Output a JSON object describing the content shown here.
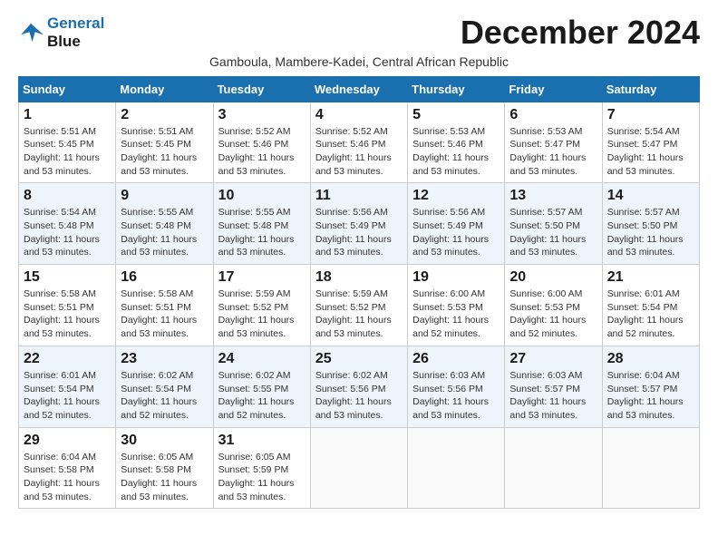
{
  "header": {
    "logo_line1": "General",
    "logo_line2": "Blue",
    "title": "December 2024",
    "subtitle": "Gamboula, Mambere-Kadei, Central African Republic"
  },
  "weekdays": [
    "Sunday",
    "Monday",
    "Tuesday",
    "Wednesday",
    "Thursday",
    "Friday",
    "Saturday"
  ],
  "weeks": [
    [
      {
        "day": "1",
        "detail": "Sunrise: 5:51 AM\nSunset: 5:45 PM\nDaylight: 11 hours\nand 53 minutes."
      },
      {
        "day": "2",
        "detail": "Sunrise: 5:51 AM\nSunset: 5:45 PM\nDaylight: 11 hours\nand 53 minutes."
      },
      {
        "day": "3",
        "detail": "Sunrise: 5:52 AM\nSunset: 5:46 PM\nDaylight: 11 hours\nand 53 minutes."
      },
      {
        "day": "4",
        "detail": "Sunrise: 5:52 AM\nSunset: 5:46 PM\nDaylight: 11 hours\nand 53 minutes."
      },
      {
        "day": "5",
        "detail": "Sunrise: 5:53 AM\nSunset: 5:46 PM\nDaylight: 11 hours\nand 53 minutes."
      },
      {
        "day": "6",
        "detail": "Sunrise: 5:53 AM\nSunset: 5:47 PM\nDaylight: 11 hours\nand 53 minutes."
      },
      {
        "day": "7",
        "detail": "Sunrise: 5:54 AM\nSunset: 5:47 PM\nDaylight: 11 hours\nand 53 minutes."
      }
    ],
    [
      {
        "day": "8",
        "detail": "Sunrise: 5:54 AM\nSunset: 5:48 PM\nDaylight: 11 hours\nand 53 minutes."
      },
      {
        "day": "9",
        "detail": "Sunrise: 5:55 AM\nSunset: 5:48 PM\nDaylight: 11 hours\nand 53 minutes."
      },
      {
        "day": "10",
        "detail": "Sunrise: 5:55 AM\nSunset: 5:48 PM\nDaylight: 11 hours\nand 53 minutes."
      },
      {
        "day": "11",
        "detail": "Sunrise: 5:56 AM\nSunset: 5:49 PM\nDaylight: 11 hours\nand 53 minutes."
      },
      {
        "day": "12",
        "detail": "Sunrise: 5:56 AM\nSunset: 5:49 PM\nDaylight: 11 hours\nand 53 minutes."
      },
      {
        "day": "13",
        "detail": "Sunrise: 5:57 AM\nSunset: 5:50 PM\nDaylight: 11 hours\nand 53 minutes."
      },
      {
        "day": "14",
        "detail": "Sunrise: 5:57 AM\nSunset: 5:50 PM\nDaylight: 11 hours\nand 53 minutes."
      }
    ],
    [
      {
        "day": "15",
        "detail": "Sunrise: 5:58 AM\nSunset: 5:51 PM\nDaylight: 11 hours\nand 53 minutes."
      },
      {
        "day": "16",
        "detail": "Sunrise: 5:58 AM\nSunset: 5:51 PM\nDaylight: 11 hours\nand 53 minutes."
      },
      {
        "day": "17",
        "detail": "Sunrise: 5:59 AM\nSunset: 5:52 PM\nDaylight: 11 hours\nand 53 minutes."
      },
      {
        "day": "18",
        "detail": "Sunrise: 5:59 AM\nSunset: 5:52 PM\nDaylight: 11 hours\nand 53 minutes."
      },
      {
        "day": "19",
        "detail": "Sunrise: 6:00 AM\nSunset: 5:53 PM\nDaylight: 11 hours\nand 52 minutes."
      },
      {
        "day": "20",
        "detail": "Sunrise: 6:00 AM\nSunset: 5:53 PM\nDaylight: 11 hours\nand 52 minutes."
      },
      {
        "day": "21",
        "detail": "Sunrise: 6:01 AM\nSunset: 5:54 PM\nDaylight: 11 hours\nand 52 minutes."
      }
    ],
    [
      {
        "day": "22",
        "detail": "Sunrise: 6:01 AM\nSunset: 5:54 PM\nDaylight: 11 hours\nand 52 minutes."
      },
      {
        "day": "23",
        "detail": "Sunrise: 6:02 AM\nSunset: 5:54 PM\nDaylight: 11 hours\nand 52 minutes."
      },
      {
        "day": "24",
        "detail": "Sunrise: 6:02 AM\nSunset: 5:55 PM\nDaylight: 11 hours\nand 52 minutes."
      },
      {
        "day": "25",
        "detail": "Sunrise: 6:02 AM\nSunset: 5:56 PM\nDaylight: 11 hours\nand 53 minutes."
      },
      {
        "day": "26",
        "detail": "Sunrise: 6:03 AM\nSunset: 5:56 PM\nDaylight: 11 hours\nand 53 minutes."
      },
      {
        "day": "27",
        "detail": "Sunrise: 6:03 AM\nSunset: 5:57 PM\nDaylight: 11 hours\nand 53 minutes."
      },
      {
        "day": "28",
        "detail": "Sunrise: 6:04 AM\nSunset: 5:57 PM\nDaylight: 11 hours\nand 53 minutes."
      }
    ],
    [
      {
        "day": "29",
        "detail": "Sunrise: 6:04 AM\nSunset: 5:58 PM\nDaylight: 11 hours\nand 53 minutes."
      },
      {
        "day": "30",
        "detail": "Sunrise: 6:05 AM\nSunset: 5:58 PM\nDaylight: 11 hours\nand 53 minutes."
      },
      {
        "day": "31",
        "detail": "Sunrise: 6:05 AM\nSunset: 5:59 PM\nDaylight: 11 hours\nand 53 minutes."
      },
      {
        "day": "",
        "detail": ""
      },
      {
        "day": "",
        "detail": ""
      },
      {
        "day": "",
        "detail": ""
      },
      {
        "day": "",
        "detail": ""
      }
    ]
  ]
}
